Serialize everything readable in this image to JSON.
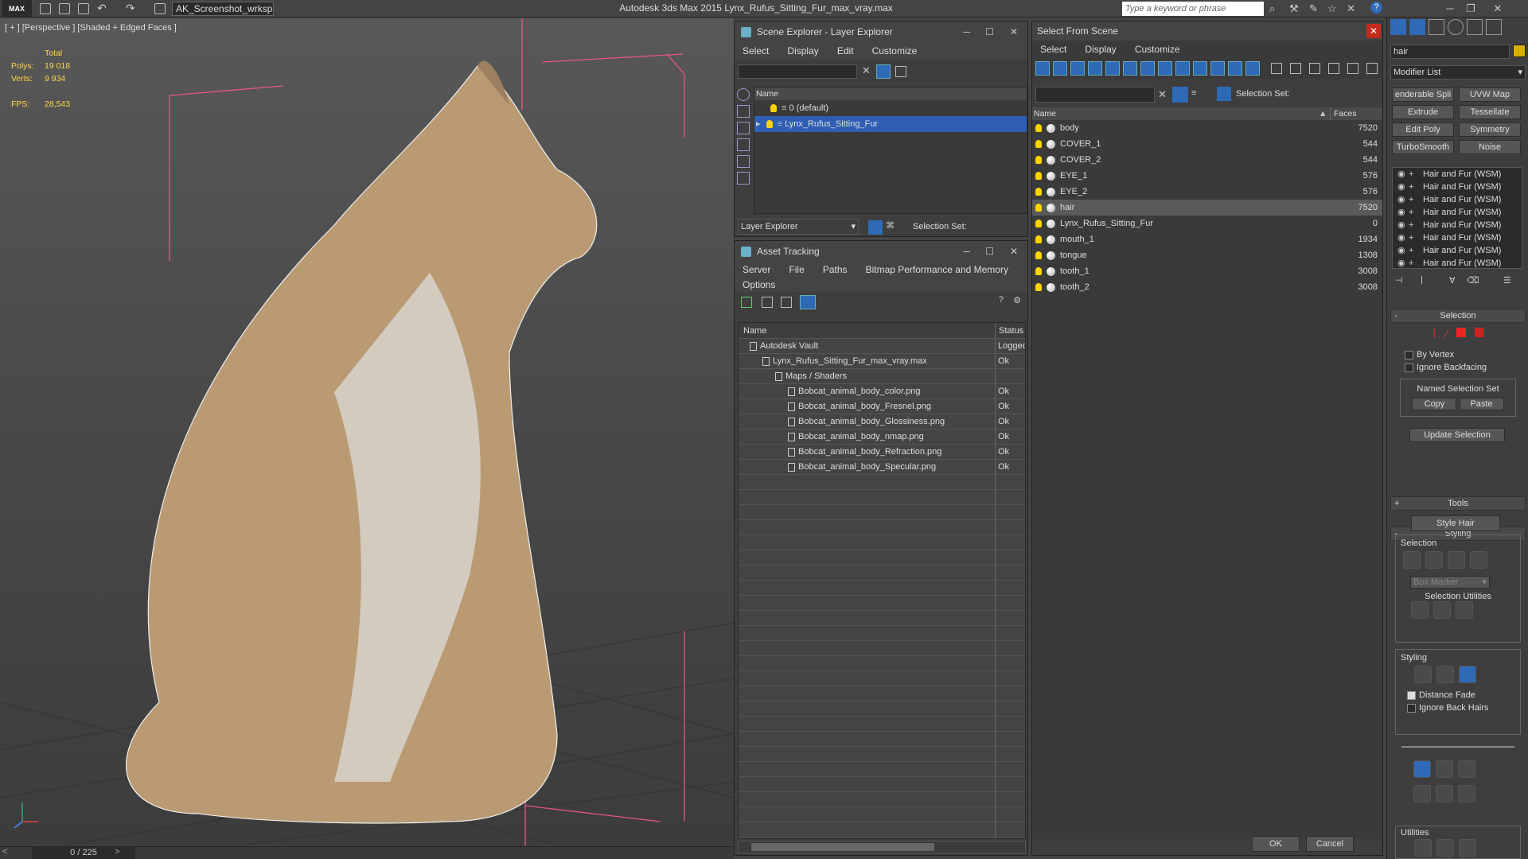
{
  "app": {
    "logo": "MAX",
    "workspace": "AK_Screenshot_wrksp",
    "title": "Autodesk 3ds Max  2015     Lynx_Rufus_Sitting_Fur_max_vray.max",
    "search_placeholder": "Type a keyword or phrase"
  },
  "viewport": {
    "label": "[ + ] [Perspective ] [Shaded + Edged Faces ]",
    "stats": {
      "total": "Total",
      "polys_label": "Polys:",
      "polys": "19 018",
      "verts_label": "Verts:",
      "verts": "9 934",
      "fps_label": "FPS:",
      "fps": "28,543"
    }
  },
  "timeline": {
    "frame": "0 / 225"
  },
  "scene_explorer": {
    "title": "Scene Explorer - Layer Explorer",
    "menu": [
      "Select",
      "Display",
      "Edit",
      "Customize"
    ],
    "col_name": "Name",
    "layers": [
      "0 (default)",
      "Lynx_Rufus_Sitting_Fur"
    ],
    "footer_dropdown": "Layer Explorer",
    "selection_set": "Selection Set:"
  },
  "asset_tracking": {
    "title": "Asset Tracking",
    "menu": [
      "Server",
      "File",
      "Paths",
      "Bitmap Performance and Memory"
    ],
    "menu2": "Options",
    "col_name": "Name",
    "col_status": "Status",
    "rows": [
      {
        "name": "Autodesk Vault",
        "status": "Logged",
        "indent": 0
      },
      {
        "name": "Lynx_Rufus_Sitting_Fur_max_vray.max",
        "status": "Ok",
        "indent": 1
      },
      {
        "name": "Maps / Shaders",
        "status": "",
        "indent": 2
      },
      {
        "name": "Bobcat_animal_body_color.png",
        "status": "Ok",
        "indent": 3
      },
      {
        "name": "Bobcat_animal_body_Fresnel.png",
        "status": "Ok",
        "indent": 3
      },
      {
        "name": "Bobcat_animal_body_Glossiness.png",
        "status": "Ok",
        "indent": 3
      },
      {
        "name": "Bobcat_animal_body_nmap.png",
        "status": "Ok",
        "indent": 3
      },
      {
        "name": "Bobcat_animal_body_Refraction.png",
        "status": "Ok",
        "indent": 3
      },
      {
        "name": "Bobcat_animal_body_Specular.png",
        "status": "Ok",
        "indent": 3
      }
    ]
  },
  "select_from_scene": {
    "title": "Select From Scene",
    "menu": [
      "Select",
      "Display",
      "Customize"
    ],
    "selection_set": "Selection Set:",
    "col_name": "Name",
    "col_faces": "Faces",
    "rows": [
      {
        "name": "body",
        "faces": "7520"
      },
      {
        "name": "COVER_1",
        "faces": "544"
      },
      {
        "name": "COVER_2",
        "faces": "544"
      },
      {
        "name": "EYE_1",
        "faces": "576"
      },
      {
        "name": "EYE_2",
        "faces": "576"
      },
      {
        "name": "hair",
        "faces": "7520"
      },
      {
        "name": "Lynx_Rufus_Sitting_Fur",
        "faces": "0"
      },
      {
        "name": "mouth_1",
        "faces": "1934"
      },
      {
        "name": "tongue",
        "faces": "1308"
      },
      {
        "name": "tooth_1",
        "faces": "3008"
      },
      {
        "name": "tooth_2",
        "faces": "3008"
      }
    ],
    "ok": "OK",
    "cancel": "Cancel"
  },
  "command_panel": {
    "object_name": "hair",
    "modifier_list": "Modifier List",
    "buttons": [
      "enderable Spli",
      "UVW Map",
      "Extrude",
      "Tessellate",
      "Edit Poly",
      "Symmetry",
      "TurboSmooth",
      "Noise"
    ],
    "stack_item": "Hair and Fur (WSM)",
    "selection_header": "Selection",
    "by_vertex": "By Vertex",
    "ignore_backfacing": "Ignore Backfacing",
    "named_sel": "Named Selection Set",
    "copy": "Copy",
    "paste": "Paste",
    "update_selection": "Update Selection",
    "tools": "Tools",
    "styling": "Styling",
    "style_hair": "Style Hair",
    "sub_selection": "Selection",
    "box_marker": "Box Marker",
    "selection_utilities": "Selection Utilities",
    "sub_styling": "Styling",
    "distance_fade": "Distance Fade",
    "ignore_back_hairs": "Ignore Back Hairs",
    "utilities": "Utilities"
  }
}
